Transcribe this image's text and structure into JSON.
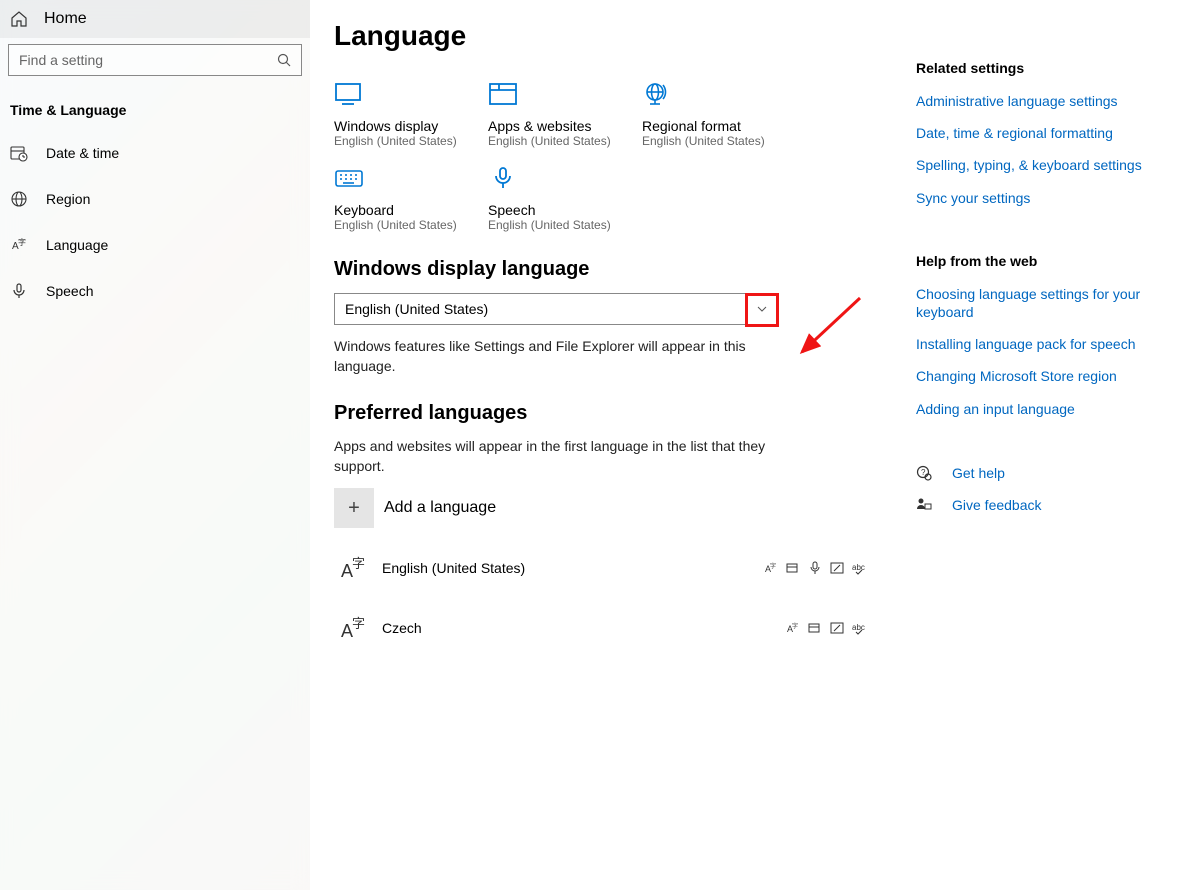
{
  "sidebar": {
    "home": "Home",
    "search_placeholder": "Find a setting",
    "category": "Time & Language",
    "items": [
      {
        "label": "Date & time"
      },
      {
        "label": "Region"
      },
      {
        "label": "Language"
      },
      {
        "label": "Speech"
      }
    ]
  },
  "page": {
    "title": "Language",
    "tiles": [
      {
        "title": "Windows display",
        "sub": "English (United States)"
      },
      {
        "title": "Apps & websites",
        "sub": "English (United States)"
      },
      {
        "title": "Regional format",
        "sub": "English (United States)"
      },
      {
        "title": "Keyboard",
        "sub": "English (United States)"
      },
      {
        "title": "Speech",
        "sub": "English (United States)"
      }
    ],
    "display_section": {
      "heading": "Windows display language",
      "selected": "English (United States)",
      "desc": "Windows features like Settings and File Explorer will appear in this language."
    },
    "preferred_section": {
      "heading": "Preferred languages",
      "desc": "Apps and websites will appear in the first language in the list that they support.",
      "add_label": "Add a language",
      "langs": [
        {
          "name": "English (United States)"
        },
        {
          "name": "Czech"
        }
      ]
    }
  },
  "right": {
    "related_heading": "Related settings",
    "related": [
      "Administrative language settings",
      "Date, time & regional formatting",
      "Spelling, typing, & keyboard settings",
      "Sync your settings"
    ],
    "help_heading": "Help from the web",
    "help": [
      "Choosing language settings for your keyboard",
      "Installing language pack for speech",
      "Changing Microsoft Store region",
      "Adding an input language"
    ],
    "get_help": "Get help",
    "feedback": "Give feedback"
  }
}
